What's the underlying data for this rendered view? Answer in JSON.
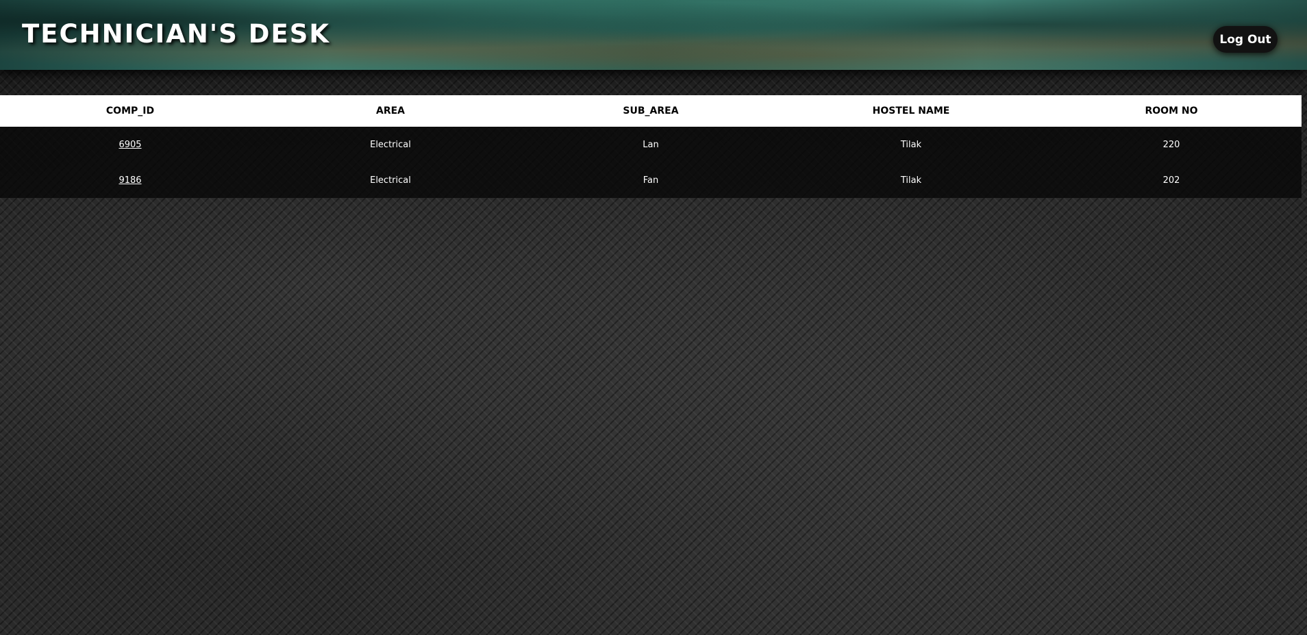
{
  "header": {
    "title": "TECHNICIAN'S DESK",
    "logout_label": "Log Out"
  },
  "table": {
    "columns": [
      "COMP_ID",
      "AREA",
      "SUB_AREA",
      "HOSTEL NAME",
      "ROOM NO"
    ],
    "rows": [
      {
        "comp_id": "6905",
        "area": "Electrical",
        "sub_area": "Lan",
        "hostel_name": "Tilak",
        "room_no": "220"
      },
      {
        "comp_id": "9186",
        "area": "Electrical",
        "sub_area": "Fan",
        "hostel_name": "Tilak",
        "room_no": "202"
      }
    ]
  }
}
